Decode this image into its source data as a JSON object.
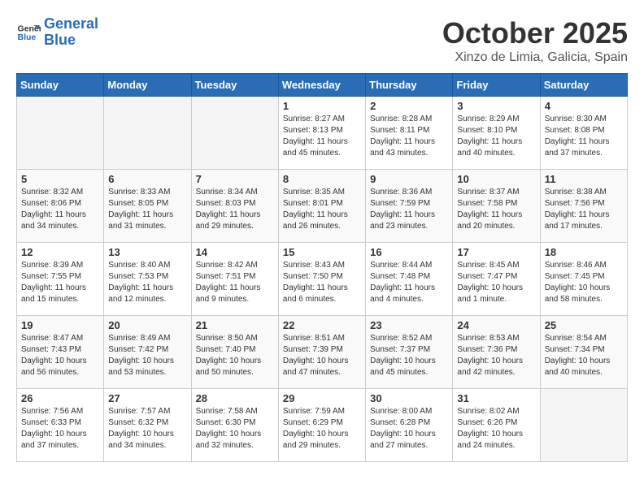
{
  "logo": {
    "line1": "General",
    "line2": "Blue"
  },
  "title": "October 2025",
  "location": "Xinzo de Limia, Galicia, Spain",
  "days_of_week": [
    "Sunday",
    "Monday",
    "Tuesday",
    "Wednesday",
    "Thursday",
    "Friday",
    "Saturday"
  ],
  "weeks": [
    [
      {
        "num": "",
        "empty": true
      },
      {
        "num": "",
        "empty": true
      },
      {
        "num": "",
        "empty": true
      },
      {
        "num": "1",
        "sunrise": "8:27 AM",
        "sunset": "8:13 PM",
        "daylight": "11 hours and 45 minutes."
      },
      {
        "num": "2",
        "sunrise": "8:28 AM",
        "sunset": "8:11 PM",
        "daylight": "11 hours and 43 minutes."
      },
      {
        "num": "3",
        "sunrise": "8:29 AM",
        "sunset": "8:10 PM",
        "daylight": "11 hours and 40 minutes."
      },
      {
        "num": "4",
        "sunrise": "8:30 AM",
        "sunset": "8:08 PM",
        "daylight": "11 hours and 37 minutes."
      }
    ],
    [
      {
        "num": "5",
        "sunrise": "8:32 AM",
        "sunset": "8:06 PM",
        "daylight": "11 hours and 34 minutes."
      },
      {
        "num": "6",
        "sunrise": "8:33 AM",
        "sunset": "8:05 PM",
        "daylight": "11 hours and 31 minutes."
      },
      {
        "num": "7",
        "sunrise": "8:34 AM",
        "sunset": "8:03 PM",
        "daylight": "11 hours and 29 minutes."
      },
      {
        "num": "8",
        "sunrise": "8:35 AM",
        "sunset": "8:01 PM",
        "daylight": "11 hours and 26 minutes."
      },
      {
        "num": "9",
        "sunrise": "8:36 AM",
        "sunset": "7:59 PM",
        "daylight": "11 hours and 23 minutes."
      },
      {
        "num": "10",
        "sunrise": "8:37 AM",
        "sunset": "7:58 PM",
        "daylight": "11 hours and 20 minutes."
      },
      {
        "num": "11",
        "sunrise": "8:38 AM",
        "sunset": "7:56 PM",
        "daylight": "11 hours and 17 minutes."
      }
    ],
    [
      {
        "num": "12",
        "sunrise": "8:39 AM",
        "sunset": "7:55 PM",
        "daylight": "11 hours and 15 minutes."
      },
      {
        "num": "13",
        "sunrise": "8:40 AM",
        "sunset": "7:53 PM",
        "daylight": "11 hours and 12 minutes."
      },
      {
        "num": "14",
        "sunrise": "8:42 AM",
        "sunset": "7:51 PM",
        "daylight": "11 hours and 9 minutes."
      },
      {
        "num": "15",
        "sunrise": "8:43 AM",
        "sunset": "7:50 PM",
        "daylight": "11 hours and 6 minutes."
      },
      {
        "num": "16",
        "sunrise": "8:44 AM",
        "sunset": "7:48 PM",
        "daylight": "11 hours and 4 minutes."
      },
      {
        "num": "17",
        "sunrise": "8:45 AM",
        "sunset": "7:47 PM",
        "daylight": "10 hours and 1 minute."
      },
      {
        "num": "18",
        "sunrise": "8:46 AM",
        "sunset": "7:45 PM",
        "daylight": "10 hours and 58 minutes."
      }
    ],
    [
      {
        "num": "19",
        "sunrise": "8:47 AM",
        "sunset": "7:43 PM",
        "daylight": "10 hours and 56 minutes."
      },
      {
        "num": "20",
        "sunrise": "8:49 AM",
        "sunset": "7:42 PM",
        "daylight": "10 hours and 53 minutes."
      },
      {
        "num": "21",
        "sunrise": "8:50 AM",
        "sunset": "7:40 PM",
        "daylight": "10 hours and 50 minutes."
      },
      {
        "num": "22",
        "sunrise": "8:51 AM",
        "sunset": "7:39 PM",
        "daylight": "10 hours and 47 minutes."
      },
      {
        "num": "23",
        "sunrise": "8:52 AM",
        "sunset": "7:37 PM",
        "daylight": "10 hours and 45 minutes."
      },
      {
        "num": "24",
        "sunrise": "8:53 AM",
        "sunset": "7:36 PM",
        "daylight": "10 hours and 42 minutes."
      },
      {
        "num": "25",
        "sunrise": "8:54 AM",
        "sunset": "7:34 PM",
        "daylight": "10 hours and 40 minutes."
      }
    ],
    [
      {
        "num": "26",
        "sunrise": "7:56 AM",
        "sunset": "6:33 PM",
        "daylight": "10 hours and 37 minutes."
      },
      {
        "num": "27",
        "sunrise": "7:57 AM",
        "sunset": "6:32 PM",
        "daylight": "10 hours and 34 minutes."
      },
      {
        "num": "28",
        "sunrise": "7:58 AM",
        "sunset": "6:30 PM",
        "daylight": "10 hours and 32 minutes."
      },
      {
        "num": "29",
        "sunrise": "7:59 AM",
        "sunset": "6:29 PM",
        "daylight": "10 hours and 29 minutes."
      },
      {
        "num": "30",
        "sunrise": "8:00 AM",
        "sunset": "6:28 PM",
        "daylight": "10 hours and 27 minutes."
      },
      {
        "num": "31",
        "sunrise": "8:02 AM",
        "sunset": "6:26 PM",
        "daylight": "10 hours and 24 minutes."
      },
      {
        "num": "",
        "empty": true
      }
    ]
  ]
}
